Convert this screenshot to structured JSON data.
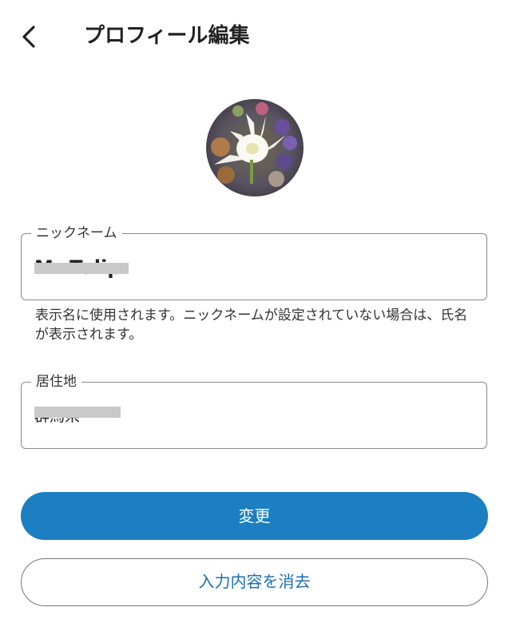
{
  "header": {
    "back_icon": "chevron-left-icon",
    "title": "プロフィール編集"
  },
  "avatar": {
    "description_icon": "white-tulip-photo"
  },
  "nickname": {
    "label": "ニックネーム",
    "value": "Mr Tulip",
    "helper": "表示名に使用されます。ニックネームが設定されていない場合は、氏名が表示されます。"
  },
  "location": {
    "label": "居住地",
    "value": "群馬県"
  },
  "actions": {
    "submit_label": "変更",
    "clear_label": "入力内容を消去"
  },
  "colors": {
    "primary": "#1b7fc1",
    "outline_text": "#1b6fb3",
    "border": "#8a8a8a"
  }
}
